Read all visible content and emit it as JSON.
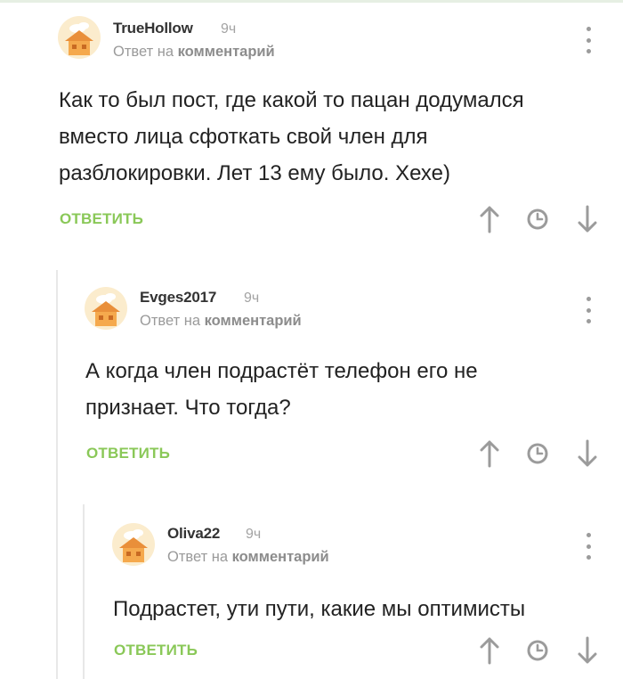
{
  "comments": [
    {
      "author": "TrueHollow",
      "time": "9ч",
      "reply_prefix": "Ответ на",
      "reply_target": "комментарий",
      "text_lines": [
        "Как то был пост, где какой то пацан додумался",
        "вместо лица сфоткать свой член для",
        "разблокировки. Лет 13 ему было. Хехе)"
      ],
      "reply_label": "ОТВЕТИТЬ"
    },
    {
      "author": "Evges2017",
      "time": "9ч",
      "reply_prefix": "Ответ на",
      "reply_target": "комментарий",
      "text_lines": [
        "А когда член подрастёт телефон его не",
        "признает. Что тогда?"
      ],
      "reply_label": "ОТВЕТИТЬ"
    },
    {
      "author": "Oliva22",
      "time": "9ч",
      "reply_prefix": "Ответ на",
      "reply_target": "комментарий",
      "text_lines": [
        "Подрастет, ути пути, какие мы оптимисты"
      ],
      "reply_label": "ОТВЕТИТЬ"
    }
  ],
  "icons": {
    "avatar": "default-avatar-icon",
    "more": "more-vertical-icon",
    "upvote": "arrow-up-icon",
    "history": "clock-icon",
    "downvote": "arrow-down-icon"
  },
  "colors": {
    "reply_accent": "#8ac858",
    "meta_gray": "#9a9a9a",
    "icon_gray": "#9b9b9b",
    "avatar_bg": "#fbeccd",
    "avatar_house": "#f0a04b"
  }
}
